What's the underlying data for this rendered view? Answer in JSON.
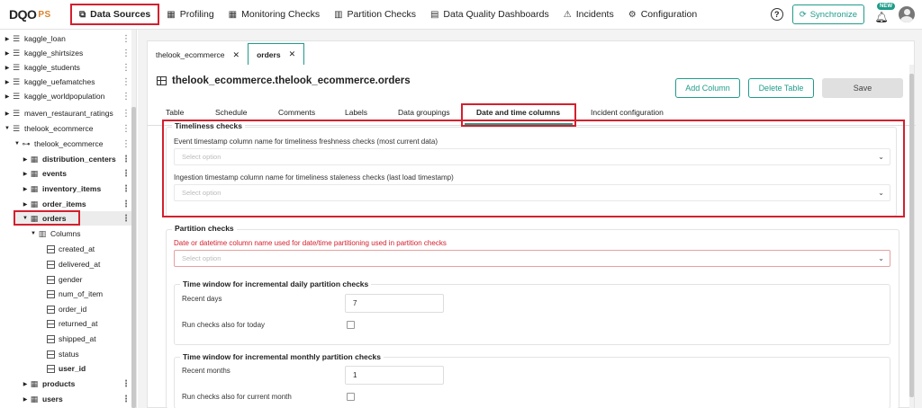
{
  "brand": {
    "logo_main": "DQO",
    "logo_sub": "PS"
  },
  "nav": [
    {
      "label": "Data Sources",
      "icon": "data-sources-icon",
      "glyph": "⧉"
    },
    {
      "label": "Profiling",
      "icon": "profiling-icon",
      "glyph": "▦"
    },
    {
      "label": "Monitoring Checks",
      "icon": "monitoring-icon",
      "glyph": "▦"
    },
    {
      "label": "Partition Checks",
      "icon": "partition-icon",
      "glyph": "▥"
    },
    {
      "label": "Data Quality Dashboards",
      "icon": "dashboard-icon",
      "glyph": "▤"
    },
    {
      "label": "Incidents",
      "icon": "warning-icon",
      "glyph": "⚠"
    },
    {
      "label": "Configuration",
      "icon": "gear-icon",
      "glyph": "⚙"
    }
  ],
  "toolbar": {
    "help": "?",
    "sync_label": "Synchronize",
    "new_badge": "NEW"
  },
  "sidebar": {
    "items": [
      {
        "label": "kaggle_loan"
      },
      {
        "label": "kaggle_shirtsizes"
      },
      {
        "label": "kaggle_students"
      },
      {
        "label": "kaggle_uefamatches"
      },
      {
        "label": "kaggle_worldpopulation"
      },
      {
        "label": "maven_restaurant_ratings"
      },
      {
        "label": "thelook_ecommerce"
      },
      {
        "label": "thelook_ecommerce"
      },
      {
        "label": "distribution_centers"
      },
      {
        "label": "events"
      },
      {
        "label": "inventory_items"
      },
      {
        "label": "order_items"
      },
      {
        "label": "orders"
      },
      {
        "label": "Columns"
      },
      {
        "label": "created_at"
      },
      {
        "label": "delivered_at"
      },
      {
        "label": "gender"
      },
      {
        "label": "num_of_item"
      },
      {
        "label": "order_id"
      },
      {
        "label": "returned_at"
      },
      {
        "label": "shipped_at"
      },
      {
        "label": "status"
      },
      {
        "label": "user_id"
      },
      {
        "label": "products"
      },
      {
        "label": "users"
      }
    ]
  },
  "file_tabs": [
    {
      "label": "thelook_ecommerce",
      "close": "✕"
    },
    {
      "label": "orders",
      "close": "✕"
    }
  ],
  "table": {
    "title": "thelook_ecommerce.thelook_ecommerce.orders",
    "add_column": "Add Column",
    "delete_table": "Delete Table",
    "save": "Save"
  },
  "tabs": [
    "Table",
    "Schedule",
    "Comments",
    "Labels",
    "Data groupings",
    "Date and time columns",
    "Incident configuration"
  ],
  "timeliness": {
    "legend": "Timeliness checks",
    "event_label": "Event timestamp column name for timeliness freshness checks (most current data)",
    "event_placeholder": "Select option",
    "ingestion_label": "Ingestion timestamp column name for timeliness staleness checks (last load timestamp)",
    "ingestion_placeholder": "Select option"
  },
  "partition": {
    "legend": "Partition checks",
    "partition_label": "Date or datetime column name used for date/time partitioning used in partition checks",
    "partition_placeholder": "Select option",
    "daily_legend": "Time window for incremental daily partition checks",
    "recent_days_label": "Recent days",
    "recent_days_value": "7",
    "today_label": "Run checks also for today",
    "monthly_legend": "Time window for incremental monthly partition checks",
    "recent_months_label": "Recent months",
    "recent_months_value": "1",
    "current_month_label": "Run checks also for current month"
  }
}
